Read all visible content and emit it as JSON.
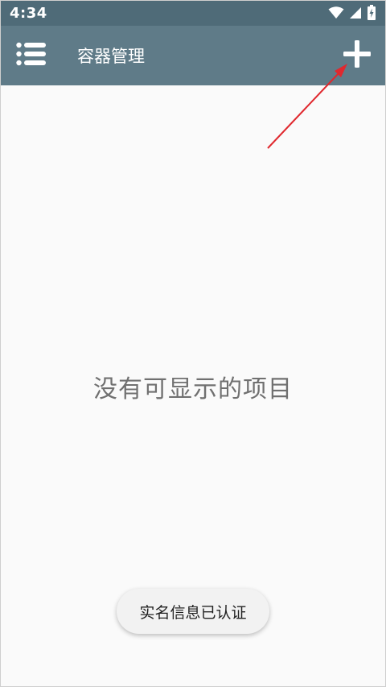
{
  "status_bar": {
    "time": "4:34",
    "icons": [
      "wifi-icon",
      "cellular-signal-icon",
      "battery-charging-icon"
    ]
  },
  "app_bar": {
    "title": "容器管理",
    "menu_icon": "list-menu-icon",
    "add_icon": "plus-icon"
  },
  "main": {
    "empty_message": "没有可显示的项目"
  },
  "toast": {
    "message": "实名信息已认证"
  },
  "colors": {
    "status_bar": "#4f6b78",
    "app_bar": "#5f7b88",
    "background": "#fafafa",
    "annotation_arrow": "#e0282e"
  }
}
